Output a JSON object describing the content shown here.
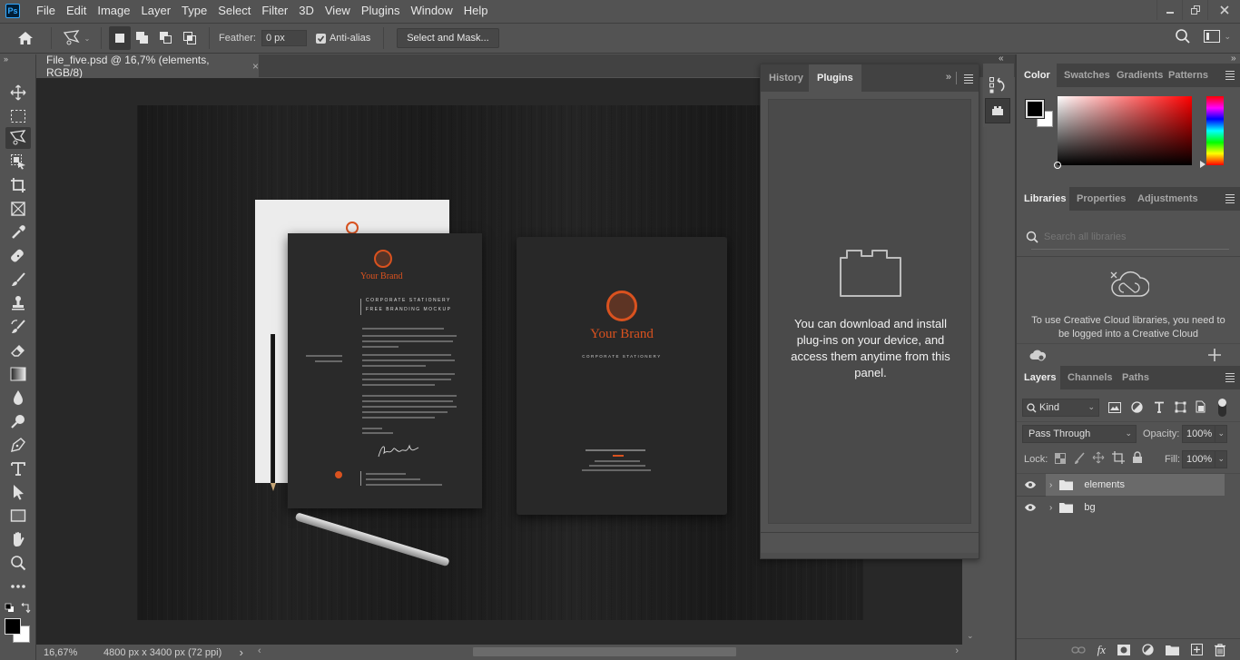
{
  "app": {
    "logo": "Ps",
    "menu": [
      "File",
      "Edit",
      "Image",
      "Layer",
      "Type",
      "Select",
      "Filter",
      "3D",
      "View",
      "Plugins",
      "Window",
      "Help"
    ],
    "window_controls": {
      "minimize": "minimize-icon",
      "restore": "restore-icon",
      "close": "close-icon"
    }
  },
  "options_bar": {
    "tool_icon": "polygonal-lasso-icon",
    "selection_modes": [
      "new-selection",
      "add-to-selection",
      "subtract-from-selection",
      "intersect-with-selection"
    ],
    "feather_label": "Feather:",
    "feather_value": "0 px",
    "antialias_label": "Anti-alias",
    "antialias_checked": true,
    "select_mask_label": "Select and Mask..."
  },
  "document": {
    "tab_title": "File_five.psd @ 16,7% (elements, RGB/8)",
    "close_glyph": "×",
    "zoom": "16,67%",
    "doc_info": "4800 px x 3400 px (72 ppi)",
    "status_arrow": "›"
  },
  "artwork": {
    "brand_name": "Your Brand",
    "letter_heading": "CORPORATE STATIONERY",
    "letter_subheading": "FREE BRANDING MOCKUP",
    "folder_subtitle": "CORPORATE STATIONERY",
    "accent_color": "#d9521f"
  },
  "tools": [
    "move",
    "rectangular-marquee",
    "polygonal-lasso",
    "object-selection",
    "crop",
    "frame",
    "eyedropper",
    "healing-brush",
    "brush",
    "clone-stamp",
    "history-brush",
    "eraser",
    "gradient",
    "blur",
    "dodge",
    "pen",
    "type",
    "path-selection",
    "rectangle",
    "hand",
    "zoom",
    "edit-toolbar"
  ],
  "active_tool": "polygonal-lasso",
  "colors": {
    "foreground": "#000000",
    "background": "#ffffff"
  },
  "plugins_panel": {
    "tabs": [
      "History",
      "Plugins"
    ],
    "active_tab": "Plugins",
    "message": "You can download and install plug-ins on your device, and access them anytime from this panel."
  },
  "color_panel": {
    "tabs": [
      "Color",
      "Swatches",
      "Gradients",
      "Patterns"
    ],
    "active_tab": "Color",
    "hue": "#ff0000"
  },
  "libraries_panel": {
    "tabs": [
      "Libraries",
      "Properties",
      "Adjustments"
    ],
    "active_tab": "Libraries",
    "search_placeholder": "Search all libraries",
    "message": "To use Creative Cloud libraries, you need to be logged into a Creative Cloud"
  },
  "layers_panel": {
    "tabs": [
      "Layers",
      "Channels",
      "Paths"
    ],
    "active_tab": "Layers",
    "filter_kind": "Kind",
    "blend_mode": "Pass Through",
    "opacity_label": "Opacity:",
    "opacity_value": "100%",
    "lock_label": "Lock:",
    "fill_label": "Fill:",
    "fill_value": "100%",
    "layers": [
      {
        "name": "elements",
        "type": "group",
        "visible": true,
        "selected": true
      },
      {
        "name": "bg",
        "type": "group",
        "visible": true,
        "selected": false
      }
    ],
    "footer_icons": [
      "link-layers",
      "fx",
      "add-mask",
      "adjustment-layer",
      "new-group",
      "new-layer",
      "delete"
    ]
  }
}
